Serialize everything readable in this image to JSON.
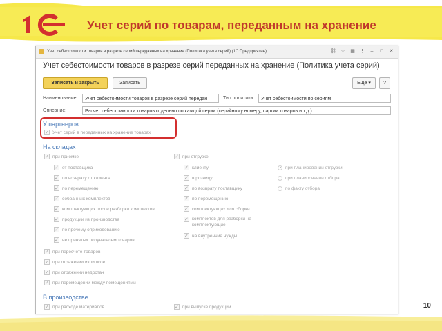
{
  "slide": {
    "title": "Учет серий по товарам, переданным на хранение",
    "page_number": "10",
    "logo_text": "1С",
    "colors": {
      "banner": "#f6e84a",
      "title": "#c0392b",
      "accent": "#4a7ab8",
      "highlight": "#d32f2f"
    }
  },
  "window": {
    "titlebar": "Учет себестоимости товаров в разрезе серий переданных на хранение (Политика учета серий) (1С:Предприятие)",
    "form_title": "Учет себестоимости товаров в разрезе серий переданных на хранение (Политика учета серий)",
    "toolbar": {
      "save_close": "Записать и закрыть",
      "save": "Записать",
      "more": "Еще ▾",
      "help": "?"
    },
    "fields": {
      "name_label": "Наименование:",
      "name_value": "Учет себестоимости товаров в разрезе серий передан",
      "policy_type_label": "Тип политики:",
      "policy_type_value": "Учет себестоимости по сериям",
      "description_label": "Описание:",
      "description_value": "Расчет себестоимости товаров отдельно по каждой серии (серийному номеру, партии товаров и т.д.)"
    },
    "partners": {
      "header": "У партнеров",
      "item": "Учет серий в переданных на хранение товарах"
    },
    "warehouses": {
      "header": "На складах",
      "left": [
        "при приемке",
        "от поставщика",
        "по возврату от клиента",
        "по перемещению",
        "собранных комплектов",
        "комплектующих после разборки комплектов",
        "продукции из производства",
        "по прочему оприходованию",
        "не принятых получателем товаров",
        "при пересчете товаров",
        "при отражении излишков",
        "при отражении недостач",
        "при перемещении между помещениями"
      ],
      "middle": [
        "при отгрузке",
        "клиенту",
        "в розницу",
        "по возврату поставщику",
        "по перемещению",
        "комплектующих для сборки",
        "комплектов для разборки на комплектующие",
        "на внутренние нужды"
      ],
      "right": [
        "при планировании отгрузки",
        "при планировании отбора",
        "по факту отбора"
      ]
    },
    "production": {
      "header": "В производстве",
      "left": "при расходе материалов",
      "right": "при выпуске продукции"
    }
  }
}
